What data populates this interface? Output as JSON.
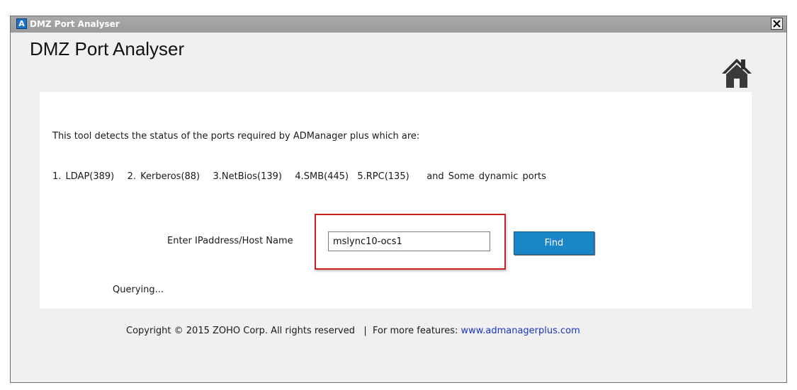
{
  "window": {
    "title": "DMZ Port Analyser",
    "icon_letter": "A",
    "close_icon": "close-icon"
  },
  "header": {
    "title": "DMZ Port Analyser",
    "home_icon": "home-icon"
  },
  "main": {
    "description": "This tool detects the status of the ports required by ADManager plus which are:",
    "ports_line": "1. LDAP(389)   2. Kerberos(88)   3.NetBios(139)   4.SMB(445)  5.RPC(135)    and Some dynamic ports",
    "host_label": "Enter IPaddress/Host Name",
    "host_value": "mslync10-ocs1",
    "find_label": "Find",
    "status_text": "Querying..."
  },
  "footer": {
    "copyright": "Copyright © 2015 ZOHO Corp. All rights reserved   |  For more features: ",
    "link_text": "www.admanagerplus.com"
  },
  "colors": {
    "titlebar": "#9a9a9a",
    "find_button": "#1a86c8",
    "highlight_border": "#cc1f1f",
    "link": "#1a35c9"
  }
}
